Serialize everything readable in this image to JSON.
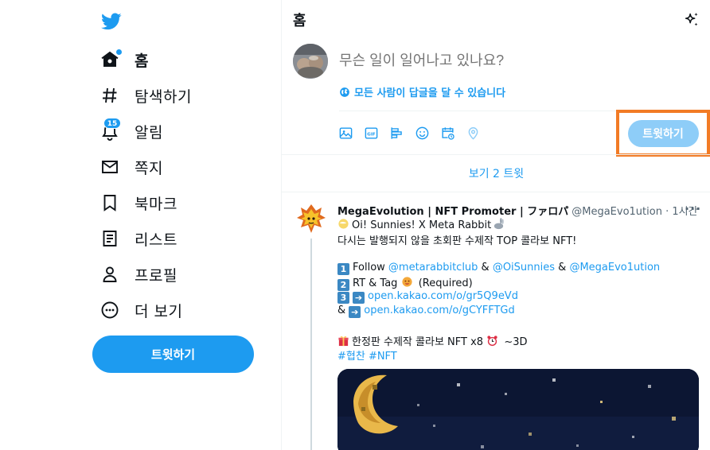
{
  "nav": {
    "items": [
      {
        "label": "홈",
        "icon": "home-icon"
      },
      {
        "label": "탐색하기",
        "icon": "hashtag-icon"
      },
      {
        "label": "알림",
        "icon": "bell-icon",
        "badge": "15"
      },
      {
        "label": "쪽지",
        "icon": "envelope-icon"
      },
      {
        "label": "북마크",
        "icon": "bookmark-icon"
      },
      {
        "label": "리스트",
        "icon": "list-icon"
      },
      {
        "label": "프로필",
        "icon": "person-icon"
      },
      {
        "label": "더 보기",
        "icon": "more-circle-icon"
      }
    ],
    "tweet_button": "트윗하기"
  },
  "header": {
    "title": "홈"
  },
  "composer": {
    "placeholder": "무슨 일이 일어나고 있나요?",
    "reply_setting": "모든 사람이 답글을 달 수 있습니다",
    "tweet_button": "트윗하기"
  },
  "timeline": {
    "show_more": "보기 2 트윗"
  },
  "tweet": {
    "name": "MegaEvolution | NFT Promoter | ファロパ",
    "handle": "@MegaEvo1ution · 1시간",
    "line1": "Oi! Sunnies! X Meta Rabbit",
    "line2": "다시는 발행되지 않을 초회판 수제작 TOP 콜라보 NFT!",
    "step1_label": "Follow ",
    "step1_link1": "@metarabbitclub",
    "step1_sep1": " & ",
    "step1_link2": "@OiSunnies",
    "step1_sep2": " & ",
    "step1_link3": "@MegaEvo1ution",
    "step2_label": "RT & Tag ",
    "step2_suffix": " (Required)",
    "step3_link": "open.kakao.com/o/gr5Q9eVd",
    "step4_prefix": "& ",
    "step4_link": "open.kakao.com/o/gCYFFTGd",
    "gift_text": "한정판 수제작 콜라보 NFT x8 ",
    "gift_suffix": " ~3D",
    "hashtags": "#협찬 #NFT",
    "keycaps": [
      "1",
      "2",
      "3"
    ]
  },
  "colors": {
    "accent": "#1d9bf0",
    "accent_disabled": "#8ecdf8",
    "highlight_box": "#f27b25"
  }
}
